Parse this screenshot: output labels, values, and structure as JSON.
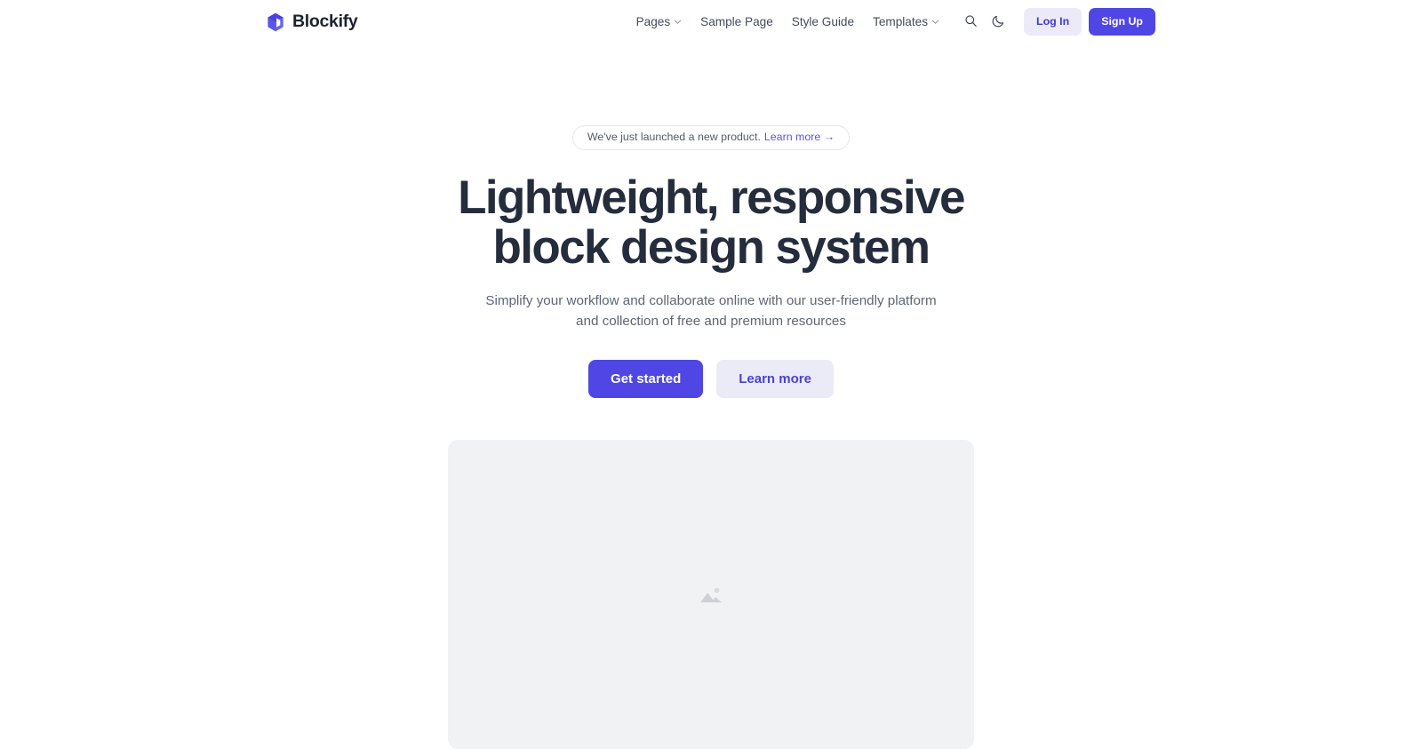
{
  "header": {
    "brand": {
      "name": "Blockify",
      "logo_icon": "cube-icon",
      "logo_color": "#4f46e5"
    },
    "nav_items": [
      {
        "label": "Pages",
        "has_dropdown": true,
        "icon": "chevron-down-icon"
      },
      {
        "label": "Sample Page",
        "has_dropdown": false
      },
      {
        "label": "Style Guide",
        "has_dropdown": false
      },
      {
        "label": "Templates",
        "has_dropdown": true,
        "icon": "chevron-down-icon"
      }
    ],
    "search_icon": "search-icon",
    "theme_toggle_icon": "moon-icon",
    "login_label": "Log In",
    "signup_label": "Sign Up"
  },
  "hero": {
    "announcement": {
      "text": "We've just launched a new product.",
      "link_label": "Learn more →"
    },
    "title_line_1": "Lightweight, responsive",
    "title_line_2": "block design system",
    "subtitle": "Simplify your workflow and collaborate online with our user-friendly platform and collection of free and premium resources",
    "primary_cta": "Get started",
    "secondary_cta": "Learn more",
    "media_placeholder_icon": "image-placeholder-icon"
  },
  "colors": {
    "accent": "#4f46e5",
    "accent_soft": "#eceaf9",
    "heading": "#252d3d",
    "body_text": "#5e6675",
    "placeholder_bg": "#f1f2f4"
  }
}
